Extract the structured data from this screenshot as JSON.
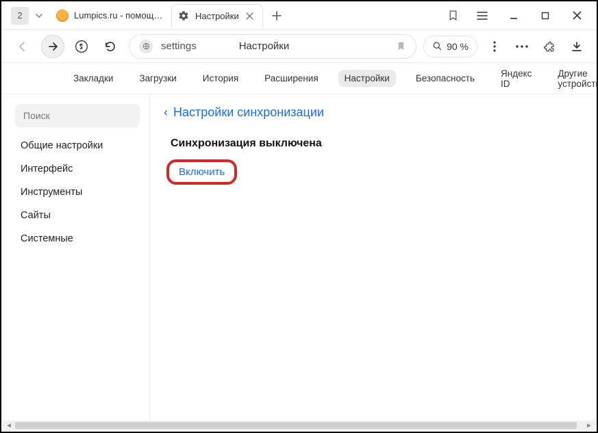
{
  "titlebar": {
    "group_count": "2",
    "tabs": [
      {
        "title": "Lumpics.ru - помощь с ком",
        "active": false,
        "favicon": "orange-circle"
      },
      {
        "title": "Настройки",
        "active": true,
        "favicon": "gear"
      }
    ]
  },
  "toolbar": {
    "url_left": "settings",
    "url_title": "Настройки",
    "zoom": "90 %"
  },
  "navtabs": {
    "items": [
      "Закладки",
      "Загрузки",
      "История",
      "Расширения",
      "Настройки",
      "Безопасность",
      "Яндекс ID",
      "Другие устройства"
    ],
    "active_index": 4
  },
  "sidebar": {
    "search_placeholder": "Поиск",
    "items": [
      "Общие настройки",
      "Интерфейс",
      "Инструменты",
      "Сайты",
      "Системные"
    ]
  },
  "main": {
    "back_title": "Настройки синхронизации",
    "sync_status": "Синхронизация выключена",
    "enable_label": "Включить"
  }
}
